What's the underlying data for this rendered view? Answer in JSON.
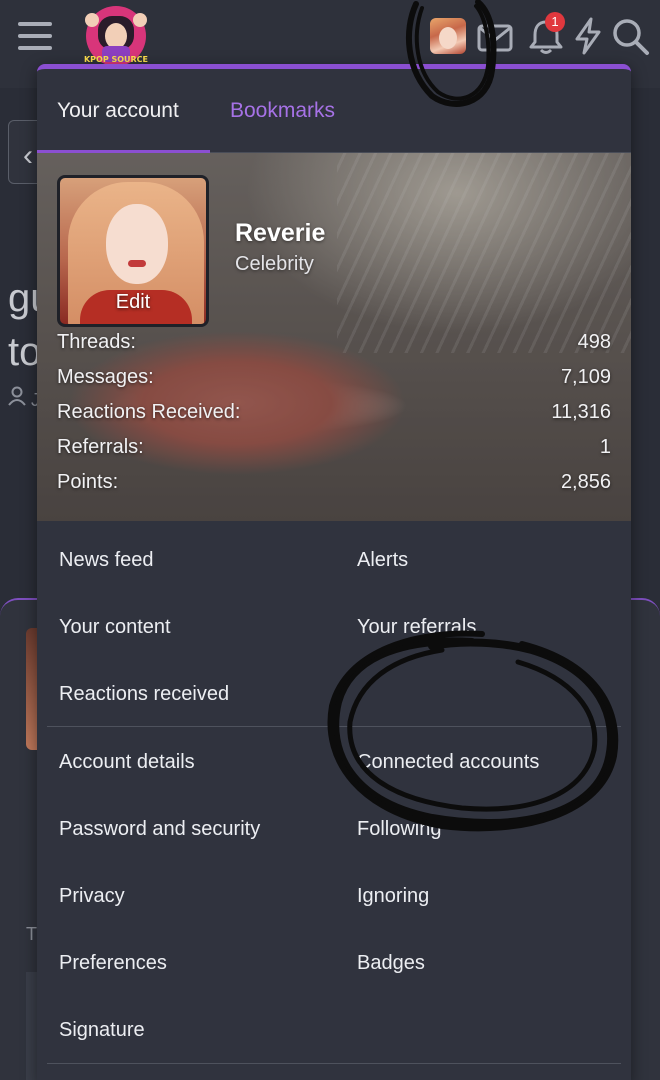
{
  "header": {
    "menu_icon": "hamburger-icon",
    "logo_label": "KPOP SOURCE",
    "icons": [
      "avatar",
      "envelope-icon",
      "bell-icon",
      "lightning-icon",
      "search-icon"
    ],
    "alerts_count": "1"
  },
  "background": {
    "title_line1": "gu",
    "title_line2": "to",
    "meta_text": "J",
    "panel_text": "T"
  },
  "menu": {
    "tabs": [
      {
        "label": "Your account",
        "active": true
      },
      {
        "label": "Bookmarks",
        "active": false
      }
    ],
    "profile": {
      "name": "Reverie",
      "title": "Celebrity",
      "edit_label": "Edit",
      "stats": [
        {
          "label": "Threads:",
          "value": "498"
        },
        {
          "label": "Messages:",
          "value": "7,109"
        },
        {
          "label": "Reactions Received:",
          "value": "11,316"
        },
        {
          "label": "Referrals:",
          "value": "1"
        },
        {
          "label": "Points:",
          "value": "2,856"
        }
      ]
    },
    "links_group1": [
      [
        "News feed",
        "Alerts"
      ],
      [
        "Your content",
        "Your referrals"
      ],
      [
        "Reactions received",
        ""
      ]
    ],
    "links_group2": [
      [
        "Account details",
        "Connected accounts"
      ],
      [
        "Password and security",
        "Following"
      ],
      [
        "Privacy",
        "Ignoring"
      ],
      [
        "Preferences",
        "Badges"
      ],
      [
        "Signature",
        ""
      ]
    ]
  },
  "colors": {
    "accent": "#8b4fd1",
    "bookmarks_tab": "#a672e6",
    "badge": "#e0383e",
    "menu_bg": "#30333e"
  }
}
